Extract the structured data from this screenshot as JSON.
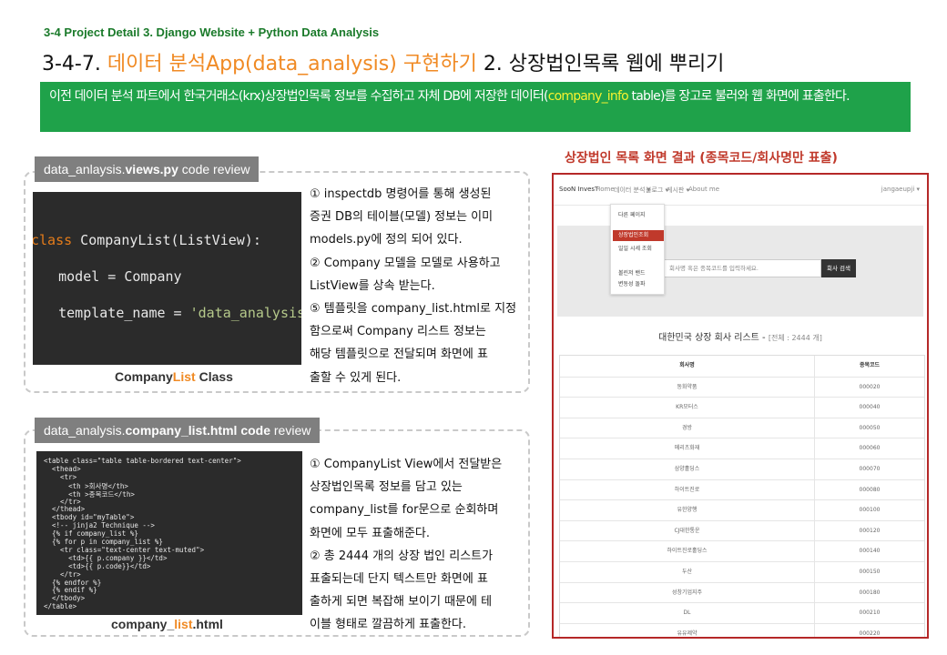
{
  "header": {
    "subhead": "3-4 Project Detail 3. Django Website + Python Data Analysis",
    "title_num": "3-4-7.",
    "title_orange1": "데이터 분석App(data_analysis)",
    "title_orange2": "구현하기",
    "title_rest": "2. 상장법인목록 웹에 뿌리기"
  },
  "banner": {
    "text_before": "이전 데이터 분석 파트에서 한국거래소(krx)상장법인목록 정보를 수집하고 자체 DB에 저장한 데이터(",
    "highlight": "company_info",
    "text_after": " table)를 장고로 불러와 웹 화면에 표출한다."
  },
  "panel1": {
    "tag_prefix": "data_anlaysis.",
    "tag_bold": "views.py",
    "tag_suffix": " code review",
    "code": {
      "l1_kw": "class",
      "l1_rest": " CompanyList(ListView):",
      "l2": "    model = Company",
      "l3_pre": "    template_name = ",
      "l3_str": "'data_analysis/company_list.html'"
    },
    "caption_a": "Company",
    "caption_b": "List",
    "caption_c": " Class",
    "desc": [
      "① inspectdb 명령어를 통해 생성된",
      "증권 DB의 테이블(모델) 정보는 이미",
      "models.py에 정의 되어 있다.",
      "② Company 모델을 모델로 사용하고",
      " ListView를 상속 받는다.",
      "⑤ 템플릿을 company_list.html로 지정",
      "함으로써 Company 리스트 정보는",
      "해당 템플릿으로 전달되며 화면에 표",
      "출할 수 있게 된다."
    ]
  },
  "panel2": {
    "tag_prefix": "data_analysis.",
    "tag_bold": "company_list.html code",
    "tag_suffix": " review",
    "code_lines": [
      {
        "cls": "c-tag",
        "text": "<table class=\"table table-bordered text-center\">"
      },
      {
        "cls": "c-tag",
        "text": "  <thead>"
      },
      {
        "cls": "c-tag",
        "text": "    <tr>"
      },
      {
        "cls": "",
        "text": "      <th >회사명</th>"
      },
      {
        "cls": "",
        "text": "      <th >종목코드</th>"
      },
      {
        "cls": "c-tag",
        "text": "    </tr>"
      },
      {
        "cls": "c-tag",
        "text": "  </thead>"
      },
      {
        "cls": "c-tag",
        "text": "  <tbody id=\"myTable\">"
      },
      {
        "cls": "c-cm",
        "text": "  <!-- jinja2 Technique -->"
      },
      {
        "cls": "",
        "text": "  {% if company_list %}"
      },
      {
        "cls": "",
        "text": "  {% for p in company_list %}"
      },
      {
        "cls": "c-tag",
        "text": "    <tr class=\"text-center text-muted\">"
      },
      {
        "cls": "",
        "text": "      <td>{{ p.company }}</td>"
      },
      {
        "cls": "",
        "text": "      <td>{{ p.code}}</td>"
      },
      {
        "cls": "c-tag",
        "text": "    </tr>"
      },
      {
        "cls": "",
        "text": "  {% endfor %}"
      },
      {
        "cls": "",
        "text": "  {% endif %}"
      },
      {
        "cls": "c-tag",
        "text": "  </tbody>"
      },
      {
        "cls": "c-tag",
        "text": "</table>"
      }
    ],
    "caption_a": "company_",
    "caption_b": "list",
    "caption_c": ".html",
    "desc": [
      "① CompanyList View에서 전달받은",
      "상장법인목록 정보를 담고 있는",
      "company_list를 for문으로 순회하며",
      "화면에 모두 표출해준다.",
      "② 총 2444 개의 상장 법인 리스트가",
      "표출되는데 단지 텍스트만 화면에 표",
      "출하게 되면 복잡해 보이기 때문에 테",
      "이블 형태로 깔끔하게 표출한다."
    ]
  },
  "result": {
    "title": "상장법인 목록 화면 결과 (종목코드/회사명만 표출)",
    "brand": "SooN InvesT",
    "nav": [
      "Home",
      "데이터 분석 ▾",
      "블로그 ▾",
      "게시판 ▾",
      "About me"
    ],
    "user": "jangaeupji ▾",
    "dropdown": [
      "다른 페이지",
      "상장법인조회",
      "일일 시세 조회",
      "볼린저 밴드",
      "변동성 돌파"
    ],
    "search_placeholder": "회사명 혹은 종목코드를 입력하세요.",
    "search_button": "회사 검색",
    "list_title": "대한민국 상장 회사 리스트 -",
    "list_count": "[전체 : 2444 개]",
    "table_headers": [
      "회사명",
      "종목코드"
    ],
    "rows": [
      [
        "동화약품",
        "000020"
      ],
      [
        "KR모터스",
        "000040"
      ],
      [
        "경방",
        "000050"
      ],
      [
        "메리츠화재",
        "000060"
      ],
      [
        "삼양홀딩스",
        "000070"
      ],
      [
        "하이트진로",
        "000080"
      ],
      [
        "유한양행",
        "000100"
      ],
      [
        "CJ대한통운",
        "000120"
      ],
      [
        "하이트진로홀딩스",
        "000140"
      ],
      [
        "두산",
        "000150"
      ],
      [
        "성창기업지주",
        "000180"
      ],
      [
        "DL",
        "000210"
      ],
      [
        "유유제약",
        "000220"
      ]
    ]
  }
}
